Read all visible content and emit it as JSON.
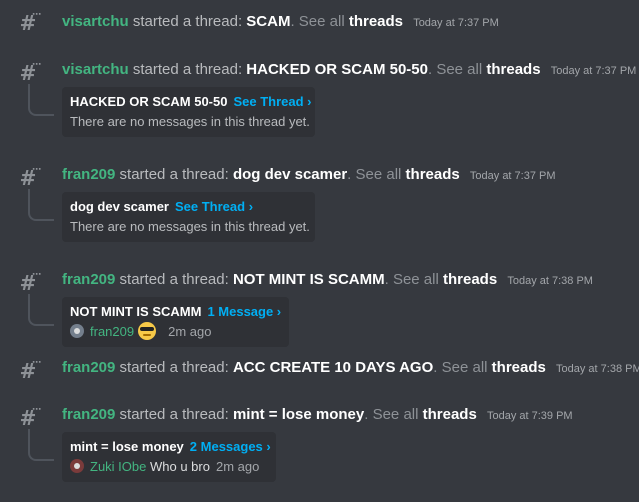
{
  "messages": [
    {
      "user": "visartchu",
      "verb": "started a thread:",
      "thread": "SCAM",
      "see": ". See all",
      "threads": "threads",
      "time": "Today at 7:37 PM"
    },
    {
      "user": "visartchu",
      "verb": "started a thread:",
      "thread": "HACKED OR SCAM 50-50",
      "see": ". See all",
      "threads": "threads",
      "time": "Today at 7:37 PM",
      "card": {
        "title": "HACKED OR SCAM 50-50",
        "link": "See Thread ›",
        "sub": "There are no messages in this thread yet."
      }
    },
    {
      "user": "fran209",
      "verb": "started a thread:",
      "thread": "dog dev scamer",
      "see": ". See all",
      "threads": "threads",
      "time": "Today at 7:37 PM",
      "card": {
        "title": "dog dev scamer",
        "link": "See Thread ›",
        "sub": "There are no messages in this thread yet."
      }
    },
    {
      "user": "fran209",
      "verb": "started a thread:",
      "thread": "NOT MINT IS SCAMM",
      "see": ". See all",
      "threads": "threads",
      "time": "Today at 7:38 PM",
      "card": {
        "title": "NOT MINT IS SCAMM",
        "link": "1 Message ›",
        "sub_user": "fran209",
        "ago": "2m ago"
      }
    },
    {
      "user": "fran209",
      "verb": "started a thread:",
      "thread": "ACC CREATE 10 DAYS AGO",
      "see": ". See all",
      "threads": "threads",
      "time": "Today at 7:38 PM"
    },
    {
      "user": "fran209",
      "verb": "started a thread:",
      "thread": "mint = lose money",
      "see": ". See all",
      "threads": "threads",
      "time": "Today at 7:39 PM",
      "card": {
        "title": "mint = lose money",
        "link": "2 Messages ›",
        "sub_user": "Zuki IObe",
        "sub_text": "Who u bro",
        "ago": "2m ago"
      }
    }
  ]
}
